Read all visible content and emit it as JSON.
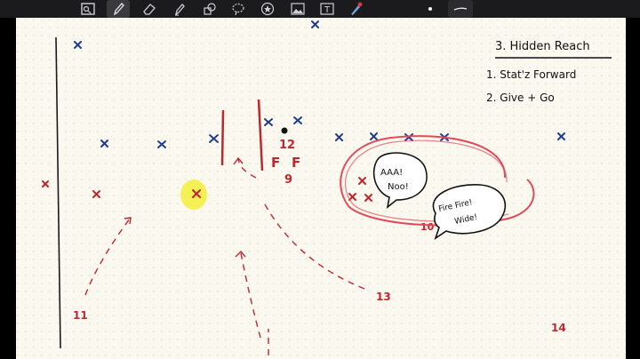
{
  "toolbar": {
    "tools": [
      "image-viewer-icon",
      "pen-icon",
      "eraser-icon",
      "highlighter-icon",
      "shapes-icon",
      "lasso-icon",
      "sticker-icon",
      "image-icon",
      "text-icon",
      "laser-pointer-icon"
    ],
    "ink_dot_color": "#ffffff",
    "active_tool": "pen-icon"
  },
  "notes": {
    "heading": "3. Hidden Reach",
    "item1": "1. Stat'z Forward",
    "item2": "2. Give + Go"
  },
  "annotations": {
    "player_12": "12",
    "player_9": "9",
    "player_10": "10",
    "player_11": "11",
    "player_13": "13",
    "player_14": "14",
    "ff_1": "F",
    "ff_2": "F",
    "bubble_1": "AAA!\nNoo!",
    "bubble_2": "Fire Fire!\nWide!"
  },
  "colors": {
    "paper": "#fbf9ef",
    "grid_dot": "#d9d6c8",
    "attacker_red": "#c0262d",
    "defender_blue": "#1f3d8a",
    "highlight_yellow": "#f2ef3a",
    "ring_red": "#e34b5a"
  }
}
